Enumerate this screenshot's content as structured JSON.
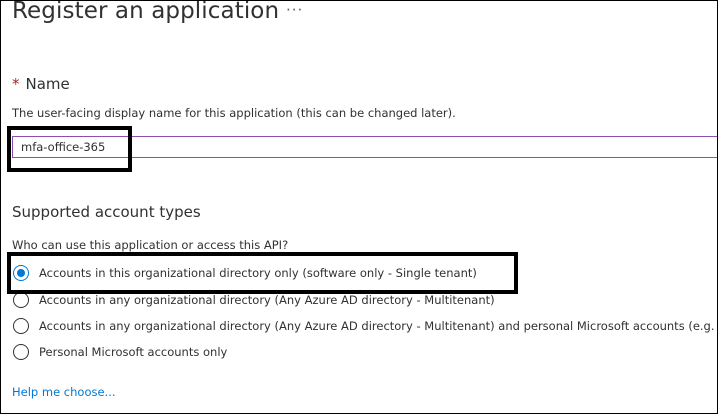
{
  "page": {
    "title": "Register an application",
    "more_glyph": "···"
  },
  "name_section": {
    "required_mark": "*",
    "label": "Name",
    "description": "The user-facing display name for this application (this can be changed later).",
    "value": "mfa-office-365"
  },
  "account_types": {
    "title": "Supported account types",
    "question": "Who can use this application or access this API?",
    "selected_index": 0,
    "options": [
      {
        "label": "Accounts in this organizational directory only (software only - Single tenant)",
        "checked": true
      },
      {
        "label": "Accounts in any organizational directory (Any Azure AD directory - Multitenant)",
        "checked": false
      },
      {
        "label": "Accounts in any organizational directory (Any Azure AD directory - Multitenant) and personal Microsoft accounts (e.g. S",
        "checked": false
      },
      {
        "label": "Personal Microsoft accounts only",
        "checked": false
      }
    ],
    "help_link": "Help me choose..."
  },
  "colors": {
    "accent": "#0078d4",
    "input_border": "#8a4fb1",
    "required": "#a4262c",
    "text": "#323130",
    "highlight_box": "#000000"
  }
}
